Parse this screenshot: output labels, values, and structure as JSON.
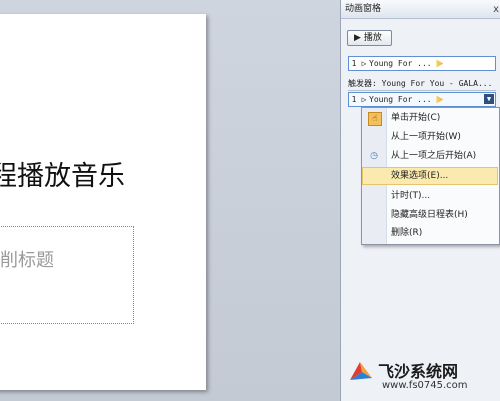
{
  "slide": {
    "title": "程播放音乐",
    "subtitle_placeholder": "削标题"
  },
  "pane": {
    "title": "动画窗格",
    "close_icon": "x",
    "play_label": "播放",
    "items": [
      {
        "num": "1",
        "name": "Young For ..."
      },
      {
        "num": "1",
        "name": "Young For ..."
      }
    ],
    "trigger_text": "触发器: Young For You - GALA..."
  },
  "menu": {
    "items": [
      {
        "label": "单击开始(C)",
        "icon": "mouse-click-icon"
      },
      {
        "label": "从上一项开始(W)",
        "icon": ""
      },
      {
        "label": "从上一项之后开始(A)",
        "icon": "clock-icon"
      },
      {
        "label": "效果选项(E)...",
        "icon": ""
      },
      {
        "label": "计时(T)...",
        "icon": ""
      },
      {
        "label": "隐藏高级日程表(H)",
        "icon": ""
      },
      {
        "label": "删除(R)",
        "icon": ""
      }
    ]
  },
  "watermark": {
    "title": "飞沙系统网",
    "url": "www.fs0745.com"
  }
}
